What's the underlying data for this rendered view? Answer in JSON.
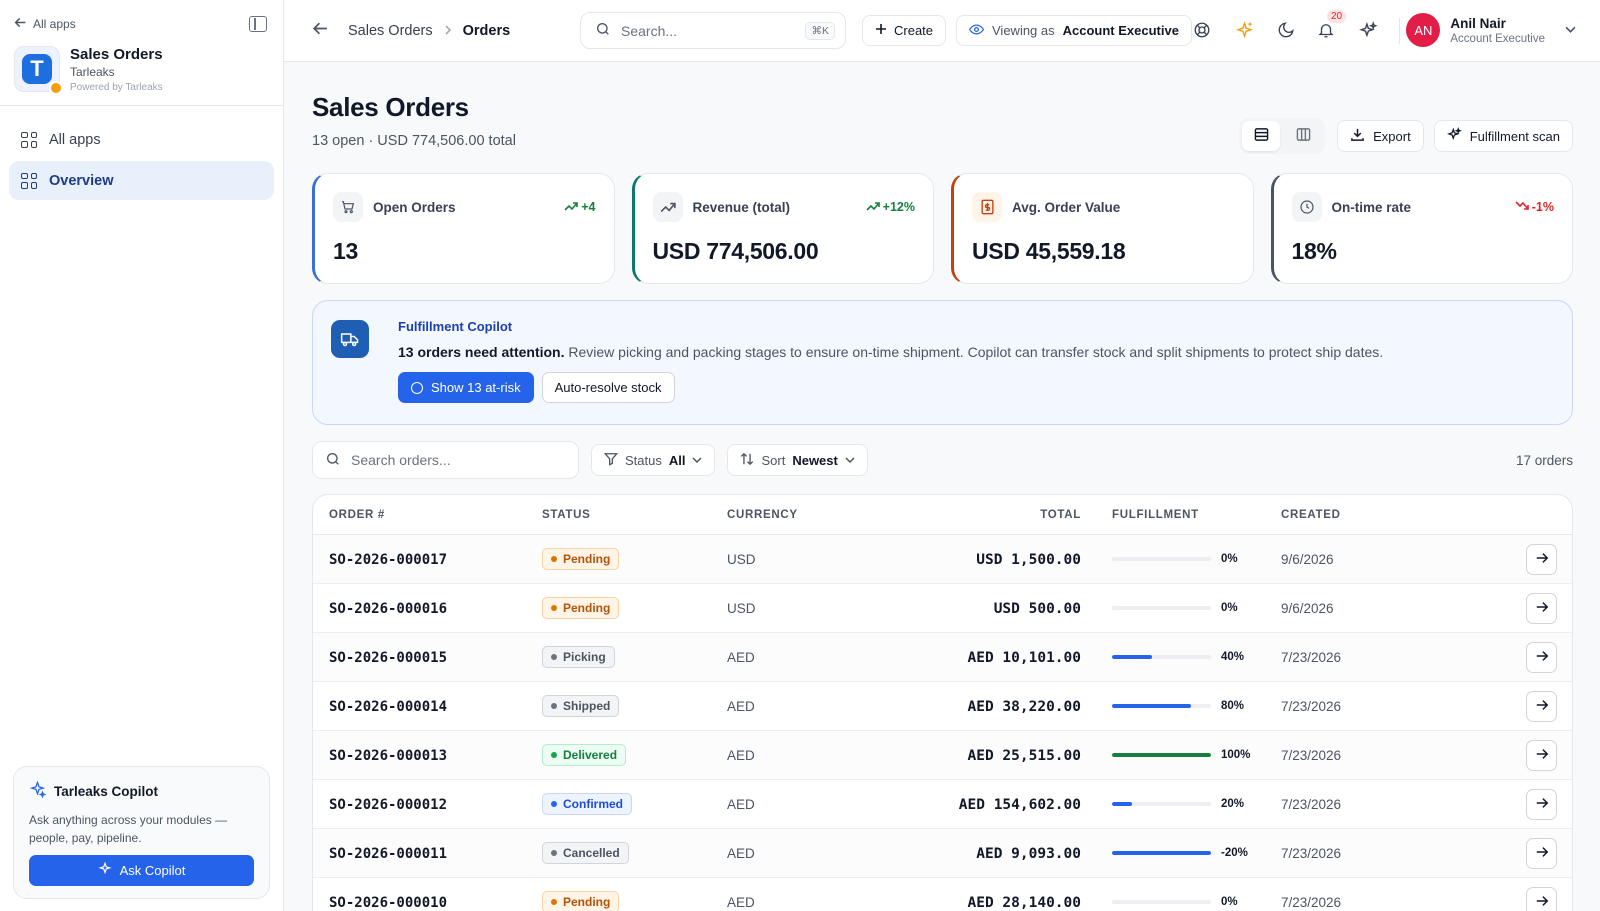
{
  "sidebar": {
    "back_label": "All apps",
    "app_title": "Sales Orders",
    "app_org": "Tarleaks",
    "app_powered": "Powered by Tarleaks",
    "logo_letter": "T",
    "nav": [
      {
        "label": "All apps",
        "active": false
      },
      {
        "label": "Overview",
        "active": true
      }
    ],
    "copilot": {
      "title": "Tarleaks Copilot",
      "text": "Ask anything across your modules — people, pay, pipeline.",
      "button": "Ask Copilot"
    }
  },
  "topbar": {
    "crumb_parent": "Sales Orders",
    "crumb_current": "Orders",
    "search_placeholder": "Search...",
    "search_kbd": "⌘K",
    "create_label": "Create",
    "viewing_prefix": "Viewing as",
    "viewing_role": "Account Executive",
    "notif_count": "20",
    "user_initials": "AN",
    "user_name": "Anil Nair",
    "user_role": "Account Executive"
  },
  "header": {
    "title": "Sales Orders",
    "subtitle": "13 open · USD 774,506.00 total",
    "export_label": "Export",
    "scan_label": "Fulfillment scan"
  },
  "kpis": [
    {
      "label": "Open Orders",
      "value": "13",
      "trend": "+4",
      "trend_dir": "up",
      "accent": "#3b6fd4",
      "icon": "cart-icon"
    },
    {
      "label": "Revenue (total)",
      "value": "USD 774,506.00",
      "trend": "+12%",
      "trend_dir": "up",
      "accent": "#0f766e",
      "icon": "trend-icon"
    },
    {
      "label": "Avg. Order Value",
      "value": "USD 45,559.18",
      "trend": "",
      "trend_dir": "none",
      "accent": "#c2410c",
      "icon": "receipt-icon"
    },
    {
      "label": "On-time rate",
      "value": "18%",
      "trend": "-1%",
      "trend_dir": "down",
      "accent": "#475569",
      "icon": "clock-icon"
    }
  ],
  "banner": {
    "title": "Fulfillment Copilot",
    "text_bold": "13 orders need attention.",
    "text_rest": " Review picking and packing stages to ensure on-time shipment. Copilot can transfer stock and split shipments to protect ship dates.",
    "primary": "Show 13 at-risk",
    "secondary": "Auto-resolve stock"
  },
  "filters": {
    "search_placeholder": "Search orders...",
    "status_label": "Status",
    "status_value": "All",
    "sort_label": "Sort",
    "sort_value": "Newest",
    "count": "17 orders"
  },
  "table": {
    "headers": [
      "ORDER #",
      "STATUS",
      "CURRENCY",
      "TOTAL",
      "FULFILLMENT",
      "CREATED"
    ],
    "rows": [
      {
        "order": "SO-2026-000017",
        "status": "Pending",
        "currency": "USD",
        "total": "USD 1,500.00",
        "fulfillment": 0,
        "fulfillment_label": "0%",
        "created": "9/6/2026"
      },
      {
        "order": "SO-2026-000016",
        "status": "Pending",
        "currency": "USD",
        "total": "USD 500.00",
        "fulfillment": 0,
        "fulfillment_label": "0%",
        "created": "9/6/2026"
      },
      {
        "order": "SO-2026-000015",
        "status": "Picking",
        "currency": "AED",
        "total": "AED 10,101.00",
        "fulfillment": 40,
        "fulfillment_label": "40%",
        "created": "7/23/2026"
      },
      {
        "order": "SO-2026-000014",
        "status": "Shipped",
        "currency": "AED",
        "total": "AED 38,220.00",
        "fulfillment": 80,
        "fulfillment_label": "80%",
        "created": "7/23/2026"
      },
      {
        "order": "SO-2026-000013",
        "status": "Delivered",
        "currency": "AED",
        "total": "AED 25,515.00",
        "fulfillment": 100,
        "fulfillment_label": "100%",
        "created": "7/23/2026"
      },
      {
        "order": "SO-2026-000012",
        "status": "Confirmed",
        "currency": "AED",
        "total": "AED 154,602.00",
        "fulfillment": 20,
        "fulfillment_label": "20%",
        "created": "7/23/2026"
      },
      {
        "order": "SO-2026-000011",
        "status": "Cancelled",
        "currency": "AED",
        "total": "AED 9,093.00",
        "fulfillment": 100,
        "fulfillment_label": "-20%",
        "created": "7/23/2026"
      },
      {
        "order": "SO-2026-000010",
        "status": "Pending",
        "currency": "AED",
        "total": "AED 28,140.00",
        "fulfillment": 0,
        "fulfillment_label": "0%",
        "created": "7/23/2026"
      }
    ]
  },
  "status_styles": {
    "Pending": {
      "bg": "#fff4e5",
      "border": "#f5d4a6",
      "text": "#b45309",
      "dot": "#d97706"
    },
    "Picking": {
      "bg": "#f3f4f6",
      "border": "#d1d5db",
      "text": "#4b5563",
      "dot": "#6b7280"
    },
    "Shipped": {
      "bg": "#f3f4f6",
      "border": "#d1d5db",
      "text": "#4b5563",
      "dot": "#6b7280"
    },
    "Delivered": {
      "bg": "#ecfdf3",
      "border": "#b7ebc9",
      "text": "#15803d",
      "dot": "#16a34a"
    },
    "Confirmed": {
      "bg": "#eef4ff",
      "border": "#c7d7f5",
      "text": "#1d4ed8",
      "dot": "#2563eb"
    },
    "Cancelled": {
      "bg": "#f3f4f6",
      "border": "#d1d5db",
      "text": "#4b5563",
      "dot": "#6b7280"
    }
  },
  "fill_colors": {
    "default": "#2563eb",
    "complete": "#15803d"
  }
}
